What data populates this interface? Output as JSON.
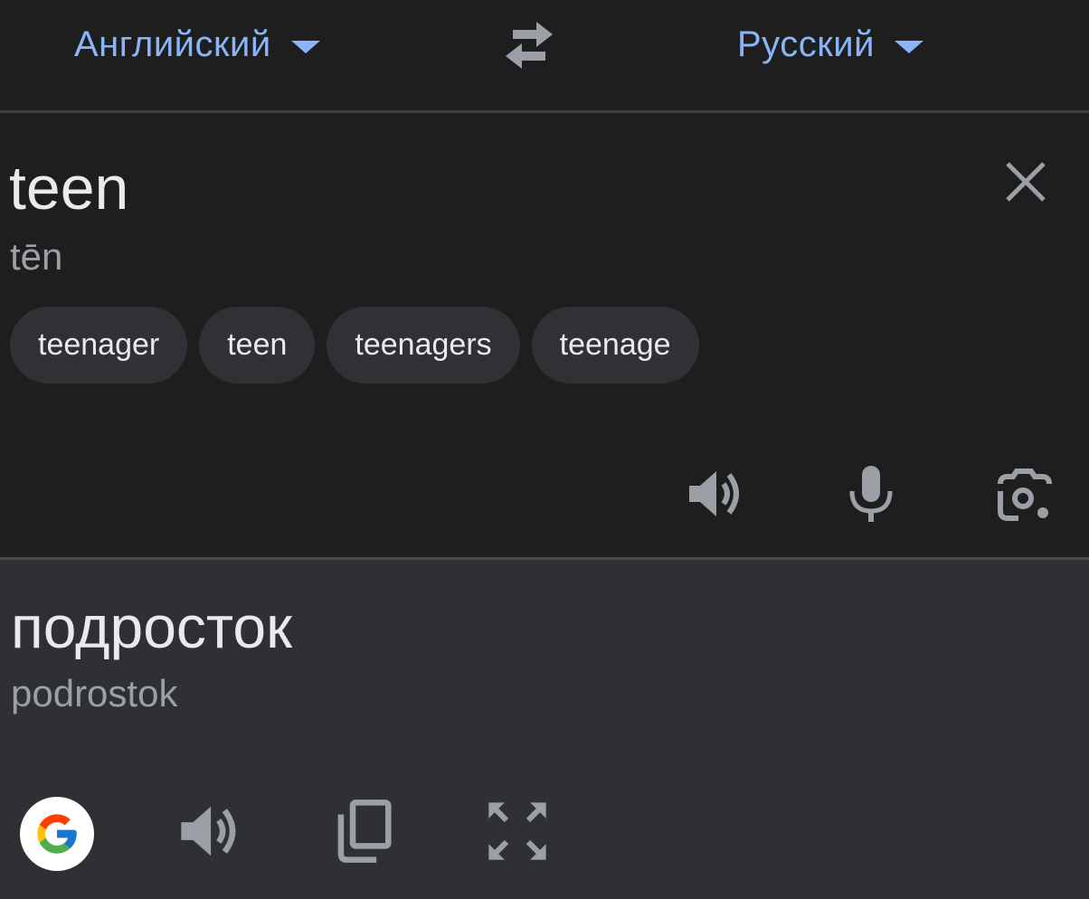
{
  "header": {
    "source_language": "Английский",
    "target_language": "Русский"
  },
  "source": {
    "text": "teen",
    "transliteration": "tēn",
    "suggestions": [
      "teenager",
      "teen",
      "teenagers",
      "teenage"
    ]
  },
  "result": {
    "text": "подросток",
    "transliteration": "podrostok"
  },
  "colors": {
    "accent": "#8ab4f8",
    "background": "#1e1e1e",
    "result_background": "#2f3033",
    "chip": "#303134",
    "icon": "#9aa0a6"
  },
  "icons": {
    "swap": "swap-languages-icon",
    "close": "close-icon",
    "speaker": "volume-icon",
    "mic": "microphone-icon",
    "camera": "camera-icon",
    "google": "google-logo",
    "copy": "copy-icon",
    "fullscreen": "fullscreen-icon"
  }
}
